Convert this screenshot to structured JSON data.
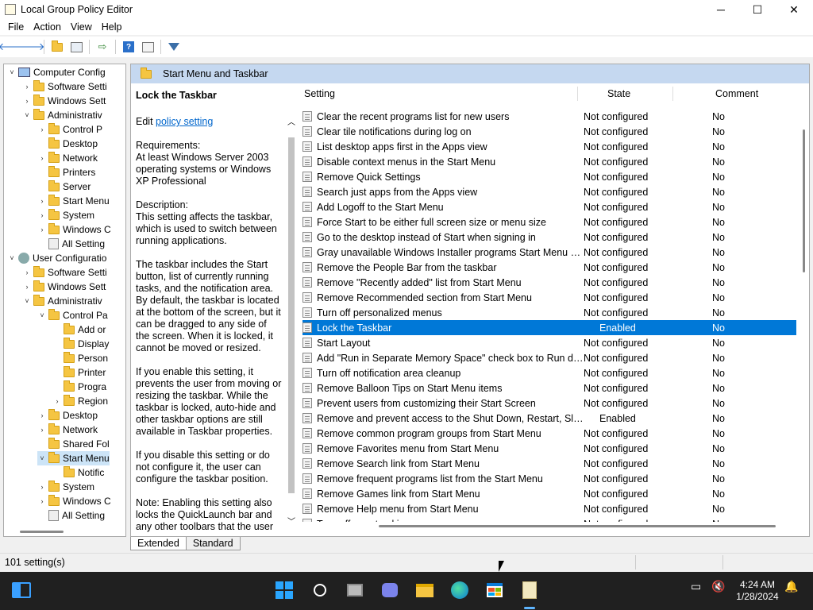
{
  "window": {
    "title": "Local Group Policy Editor",
    "controls": {
      "minimize": "─",
      "maximize": "☐",
      "close": "✕"
    }
  },
  "menu": [
    "File",
    "Action",
    "View",
    "Help"
  ],
  "toolbar": {
    "icons": [
      "back-arrow-icon",
      "forward-arrow-icon",
      "up-folder-icon",
      "show-hide-tree-icon",
      "export-list-icon",
      "help-icon",
      "properties-icon",
      "filter-icon"
    ]
  },
  "tree": [
    {
      "label": "Computer Config",
      "icon": "computer-icon",
      "toggle": "˅"
    },
    {
      "label": "Software Setti",
      "icon": "folder-icon",
      "toggle": "›"
    },
    {
      "label": "Windows Sett",
      "icon": "folder-icon",
      "toggle": "›"
    },
    {
      "label": "Administrativ",
      "icon": "folder-icon",
      "toggle": "˅"
    },
    {
      "label": "Control P",
      "icon": "folder-icon",
      "toggle": "›"
    },
    {
      "label": "Desktop",
      "icon": "folder-icon",
      "toggle": ""
    },
    {
      "label": "Network",
      "icon": "folder-icon",
      "toggle": "›"
    },
    {
      "label": "Printers",
      "icon": "folder-icon",
      "toggle": ""
    },
    {
      "label": "Server",
      "icon": "folder-icon",
      "toggle": ""
    },
    {
      "label": "Start Menu",
      "icon": "folder-icon",
      "toggle": "›"
    },
    {
      "label": "System",
      "icon": "folder-icon",
      "toggle": "›"
    },
    {
      "label": "Windows C",
      "icon": "folder-icon",
      "toggle": "›"
    },
    {
      "label": "All Setting",
      "icon": "policy-icon",
      "toggle": ""
    },
    {
      "label": "User Configuratio",
      "icon": "user-icon",
      "toggle": "˅"
    },
    {
      "label": "Software Setti",
      "icon": "folder-icon",
      "toggle": "›"
    },
    {
      "label": "Windows Sett",
      "icon": "folder-icon",
      "toggle": "›"
    },
    {
      "label": "Administrativ",
      "icon": "folder-icon",
      "toggle": "˅"
    },
    {
      "label": "Control Pa",
      "icon": "folder-icon",
      "toggle": "˅"
    },
    {
      "label": "Add or",
      "icon": "folder-icon",
      "toggle": ""
    },
    {
      "label": "Display",
      "icon": "folder-icon",
      "toggle": ""
    },
    {
      "label": "Person",
      "icon": "folder-icon",
      "toggle": ""
    },
    {
      "label": "Printer",
      "icon": "folder-icon",
      "toggle": ""
    },
    {
      "label": "Progra",
      "icon": "folder-icon",
      "toggle": ""
    },
    {
      "label": "Region",
      "icon": "folder-icon",
      "toggle": "›"
    },
    {
      "label": "Desktop",
      "icon": "folder-icon",
      "toggle": "›"
    },
    {
      "label": "Network",
      "icon": "folder-icon",
      "toggle": "›"
    },
    {
      "label": "Shared Fol",
      "icon": "folder-icon",
      "toggle": ""
    },
    {
      "label": "Start Menu",
      "icon": "folder-icon",
      "toggle": "˅",
      "selected": true
    },
    {
      "label": "Notific",
      "icon": "folder-icon",
      "toggle": ""
    },
    {
      "label": "System",
      "icon": "folder-icon",
      "toggle": "›"
    },
    {
      "label": "Windows C",
      "icon": "folder-icon",
      "toggle": "›"
    },
    {
      "label": "All Setting",
      "icon": "policy-icon",
      "toggle": ""
    }
  ],
  "content": {
    "header": "Start Menu and Taskbar",
    "description": {
      "title": "Lock the Taskbar",
      "edit_prefix": "Edit",
      "edit_link": "policy setting",
      "body": "Requirements:\nAt least Windows Server 2003 operating systems or Windows XP Professional\n\nDescription:\nThis setting affects the taskbar, which is used to switch between running applications.\n\nThe taskbar includes the Start button, list of currently running tasks, and the notification area. By default, the taskbar is located at the bottom of the screen, but it can be dragged to any side of the screen. When it is locked, it cannot be moved or resized.\n\nIf you enable this setting, it prevents the user from moving or resizing the taskbar. While the taskbar is locked, auto-hide and other taskbar options are still available in Taskbar properties.\n\nIf you disable this setting or do not configure it, the user can configure the taskbar position.\n\nNote: Enabling this setting also locks the QuickLaunch bar and any other toolbars that the user"
    },
    "columns": {
      "setting": "Setting",
      "state": "State",
      "comment": "Comment"
    },
    "rows": [
      {
        "setting": "Clear the recent programs list for new users",
        "state": "Not configured",
        "comment": "No"
      },
      {
        "setting": "Clear tile notifications during log on",
        "state": "Not configured",
        "comment": "No"
      },
      {
        "setting": "List desktop apps first in the Apps view",
        "state": "Not configured",
        "comment": "No"
      },
      {
        "setting": "Disable context menus in the Start Menu",
        "state": "Not configured",
        "comment": "No"
      },
      {
        "setting": "Remove Quick Settings",
        "state": "Not configured",
        "comment": "No"
      },
      {
        "setting": "Search just apps from the Apps view",
        "state": "Not configured",
        "comment": "No"
      },
      {
        "setting": "Add Logoff to the Start Menu",
        "state": "Not configured",
        "comment": "No"
      },
      {
        "setting": "Force Start to be either full screen size or menu size",
        "state": "Not configured",
        "comment": "No"
      },
      {
        "setting": "Go to the desktop instead of Start when signing in",
        "state": "Not configured",
        "comment": "No"
      },
      {
        "setting": "Gray unavailable Windows Installer programs Start Menu sh...",
        "state": "Not configured",
        "comment": "No"
      },
      {
        "setting": "Remove the People Bar from the taskbar",
        "state": "Not configured",
        "comment": "No"
      },
      {
        "setting": "Remove \"Recently added\" list from Start Menu",
        "state": "Not configured",
        "comment": "No"
      },
      {
        "setting": "Remove Recommended section from Start Menu",
        "state": "Not configured",
        "comment": "No"
      },
      {
        "setting": "Turn off personalized menus",
        "state": "Not configured",
        "comment": "No"
      },
      {
        "setting": "Lock the Taskbar",
        "state": "Enabled",
        "comment": "No",
        "selected": true
      },
      {
        "setting": "Start Layout",
        "state": "Not configured",
        "comment": "No"
      },
      {
        "setting": "Add \"Run in Separate Memory Space\" check box to Run dial...",
        "state": "Not configured",
        "comment": "No"
      },
      {
        "setting": "Turn off notification area cleanup",
        "state": "Not configured",
        "comment": "No"
      },
      {
        "setting": "Remove Balloon Tips on Start Menu items",
        "state": "Not configured",
        "comment": "No"
      },
      {
        "setting": "Prevent users from customizing their Start Screen",
        "state": "Not configured",
        "comment": "No"
      },
      {
        "setting": "Remove and prevent access to the Shut Down, Restart, Sleep...",
        "state": "Enabled",
        "comment": "No"
      },
      {
        "setting": "Remove common program groups from Start Menu",
        "state": "Not configured",
        "comment": "No"
      },
      {
        "setting": "Remove Favorites menu from Start Menu",
        "state": "Not configured",
        "comment": "No"
      },
      {
        "setting": "Remove Search link from Start Menu",
        "state": "Not configured",
        "comment": "No"
      },
      {
        "setting": "Remove frequent programs list from the Start Menu",
        "state": "Not configured",
        "comment": "No"
      },
      {
        "setting": "Remove Games link from Start Menu",
        "state": "Not configured",
        "comment": "No"
      },
      {
        "setting": "Remove Help menu from Start Menu",
        "state": "Not configured",
        "comment": "No"
      },
      {
        "setting": "Turn off user tracking",
        "state": "Not configured",
        "comment": "No"
      }
    ],
    "tabs": [
      "Extended",
      "Standard"
    ]
  },
  "status": {
    "text": "101 setting(s)"
  },
  "taskbar": {
    "time": "4:24 AM",
    "date": "1/28/2024",
    "apps": [
      "widgets-icon",
      "start-icon",
      "search-icon",
      "task-view-icon",
      "teams-chat-icon",
      "file-explorer-icon",
      "edge-icon",
      "store-icon",
      "group-policy-editor-icon"
    ],
    "tray": [
      "network-icon",
      "volume-muted-icon",
      "notifications-icon"
    ]
  },
  "colors": {
    "selection": "#0078d7",
    "header": "#c5d8f0",
    "taskbar": "#202020"
  }
}
